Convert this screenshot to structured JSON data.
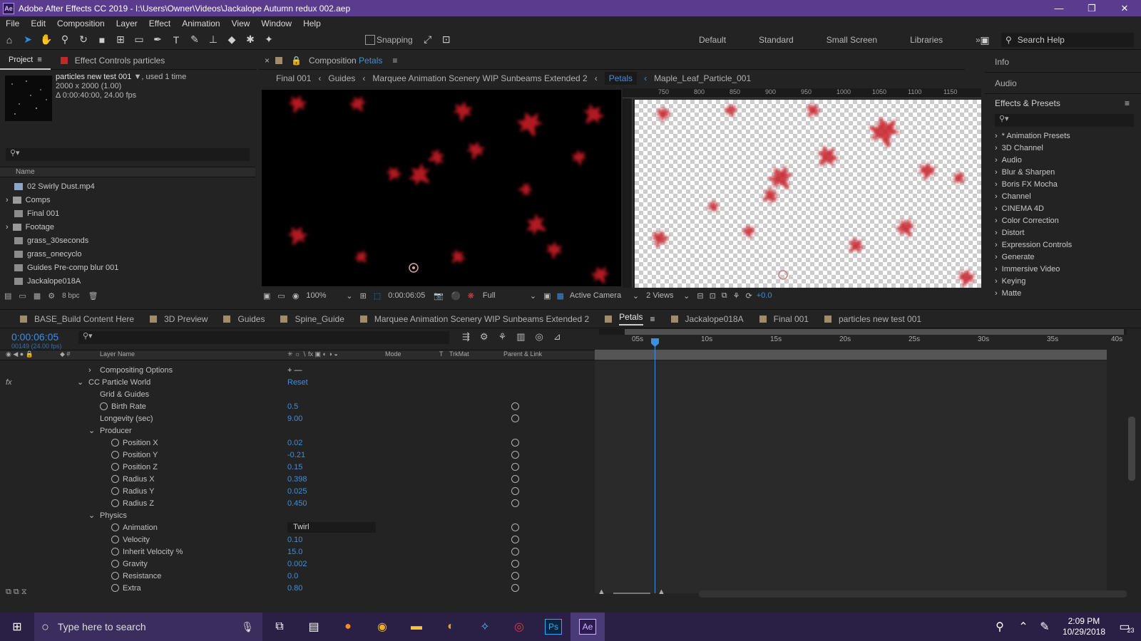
{
  "app": {
    "title": "Adobe After Effects CC 2019 - I:\\Users\\Owner\\Videos\\Jackalope Autumn redux 002.aep",
    "logo": "Ae"
  },
  "window_controls": {
    "minimize": "—",
    "maximize": "❐",
    "close": "✕"
  },
  "menu": [
    "File",
    "Edit",
    "Composition",
    "Layer",
    "Effect",
    "Animation",
    "View",
    "Window",
    "Help"
  ],
  "toolbar": {
    "snapping_label": "Snapping",
    "workspaces": [
      "Default",
      "Standard",
      "Small Screen",
      "Libraries"
    ],
    "search_help_placeholder": "Search Help"
  },
  "project_panel": {
    "tab_label": "Project",
    "effect_controls_label": "Effect Controls particles",
    "selected_item": "particles new test 001",
    "used_count": ", used 1 time",
    "dimensions": "2000 x 2000 (1.00)",
    "duration": "Δ 0:00:40:00, 24.00 fps",
    "column_name": "Name",
    "bpc": "8 bpc",
    "items": [
      {
        "name": "02 Swirly Dust.mp4",
        "type": "footage"
      },
      {
        "name": "Comps",
        "type": "folder"
      },
      {
        "name": "Final 001",
        "type": "comp"
      },
      {
        "name": "Footage",
        "type": "folder"
      },
      {
        "name": "grass_30seconds",
        "type": "comp"
      },
      {
        "name": "grass_onecyclo",
        "type": "comp"
      },
      {
        "name": "Guides Pre-comp blur 001",
        "type": "comp"
      },
      {
        "name": "Jackalope018A",
        "type": "comp"
      }
    ]
  },
  "composition_panel": {
    "title_prefix": "Composition",
    "comp_name": "Petals",
    "breadcrumbs": [
      "Final 001",
      "Guides",
      "Marquee Animation Scenery WIP Sunbeams Extended 2",
      "Petals",
      "Maple_Leaf_Particle_001"
    ],
    "zoom": "100%",
    "timecode": "0:00:06:05",
    "resolution": "Full",
    "camera": "Active Camera",
    "views": "2 Views",
    "exposure": "+0.0",
    "ruler_ticks": [
      "750",
      "800",
      "850",
      "900",
      "950",
      "1000",
      "1050",
      "1100",
      "1150"
    ]
  },
  "right_panel": {
    "info_label": "Info",
    "audio_label": "Audio",
    "effects_title": "Effects & Presets",
    "effects": [
      "* Animation Presets",
      "3D Channel",
      "Audio",
      "Blur & Sharpen",
      "Boris FX Mocha",
      "Channel",
      "CINEMA 4D",
      "Color Correction",
      "Distort",
      "Expression Controls",
      "Generate",
      "Immersive Video",
      "Keying",
      "Matte"
    ]
  },
  "timeline": {
    "tabs": [
      {
        "label": "BASE_Build Content Here",
        "color": "#a08c6a"
      },
      {
        "label": "3D Preview",
        "color": "#a08c6a"
      },
      {
        "label": "Guides",
        "color": "#a08c6a"
      },
      {
        "label": "Spine_Guide",
        "color": "#a08c6a"
      },
      {
        "label": "Marquee Animation Scenery WIP Sunbeams Extended 2",
        "color": "#a08c6a"
      },
      {
        "label": "Petals",
        "color": "#a08c6a",
        "active": true
      },
      {
        "label": "Jackalope018A",
        "color": "#a08c6a"
      },
      {
        "label": "Final 001",
        "color": "#a08c6a"
      },
      {
        "label": "particles new test 001",
        "color": "#a08c6a"
      }
    ],
    "current_time": "0:00:06:05",
    "frame_info": "00149 (24.00 fps)",
    "columns": {
      "layer_name": "Layer Name",
      "mode": "Mode",
      "t": "T",
      "trkmat": "TrkMat",
      "parent": "Parent & Link"
    },
    "ruler": [
      "05s",
      "10s",
      "15s",
      "20s",
      "25s",
      "30s",
      "35s",
      "40s"
    ],
    "properties": [
      {
        "label": "Compositing Options",
        "indent": 140,
        "kind": "collapsed",
        "value": "+ —"
      },
      {
        "label": "CC Particle World",
        "indent": 124,
        "kind": "expanded",
        "value": "Reset",
        "fx": true
      },
      {
        "label": "Grid & Guides",
        "indent": 140,
        "kind": "plain",
        "value": ""
      },
      {
        "label": "Birth Rate",
        "indent": 156,
        "kind": "stopwatch",
        "value": "0.5"
      },
      {
        "label": "Longevity (sec)",
        "indent": 140,
        "kind": "plain",
        "value": "9.00"
      },
      {
        "label": "Producer",
        "indent": 140,
        "kind": "expanded",
        "value": ""
      },
      {
        "label": "Position X",
        "indent": 172,
        "kind": "stopwatch",
        "value": "0.02"
      },
      {
        "label": "Position Y",
        "indent": 172,
        "kind": "stopwatch",
        "value": "-0.21"
      },
      {
        "label": "Position Z",
        "indent": 172,
        "kind": "stopwatch",
        "value": "0.15"
      },
      {
        "label": "Radius X",
        "indent": 172,
        "kind": "stopwatch",
        "value": "0.398"
      },
      {
        "label": "Radius Y",
        "indent": 172,
        "kind": "stopwatch",
        "value": "0.025"
      },
      {
        "label": "Radius Z",
        "indent": 172,
        "kind": "stopwatch",
        "value": "0.450"
      },
      {
        "label": "Physics",
        "indent": 140,
        "kind": "expanded",
        "value": ""
      },
      {
        "label": "Animation",
        "indent": 172,
        "kind": "dropdown",
        "value": "Twirl"
      },
      {
        "label": "Velocity",
        "indent": 172,
        "kind": "stopwatch",
        "value": "0.10"
      },
      {
        "label": "Inherit Velocity %",
        "indent": 172,
        "kind": "stopwatch",
        "value": "15.0"
      },
      {
        "label": "Gravity",
        "indent": 172,
        "kind": "stopwatch",
        "value": "0.002"
      },
      {
        "label": "Resistance",
        "indent": 172,
        "kind": "stopwatch",
        "value": "0.0"
      },
      {
        "label": "Extra",
        "indent": 172,
        "kind": "stopwatch",
        "value": "0.80"
      }
    ]
  },
  "taskbar": {
    "search_placeholder": "Type here to search",
    "apps": [
      "Firefox",
      "Chrome",
      "File Explorer",
      "Audio",
      "Sync",
      "Creative Cloud",
      "Ps",
      "Ae"
    ],
    "time": "2:09 PM",
    "date": "10/29/2018",
    "notifications": "23"
  },
  "colors": {
    "titlebar": "#5b3b8e",
    "accent_blue": "#2d8ceb",
    "panel": "#232323",
    "leaf_red": "#c0202a"
  }
}
